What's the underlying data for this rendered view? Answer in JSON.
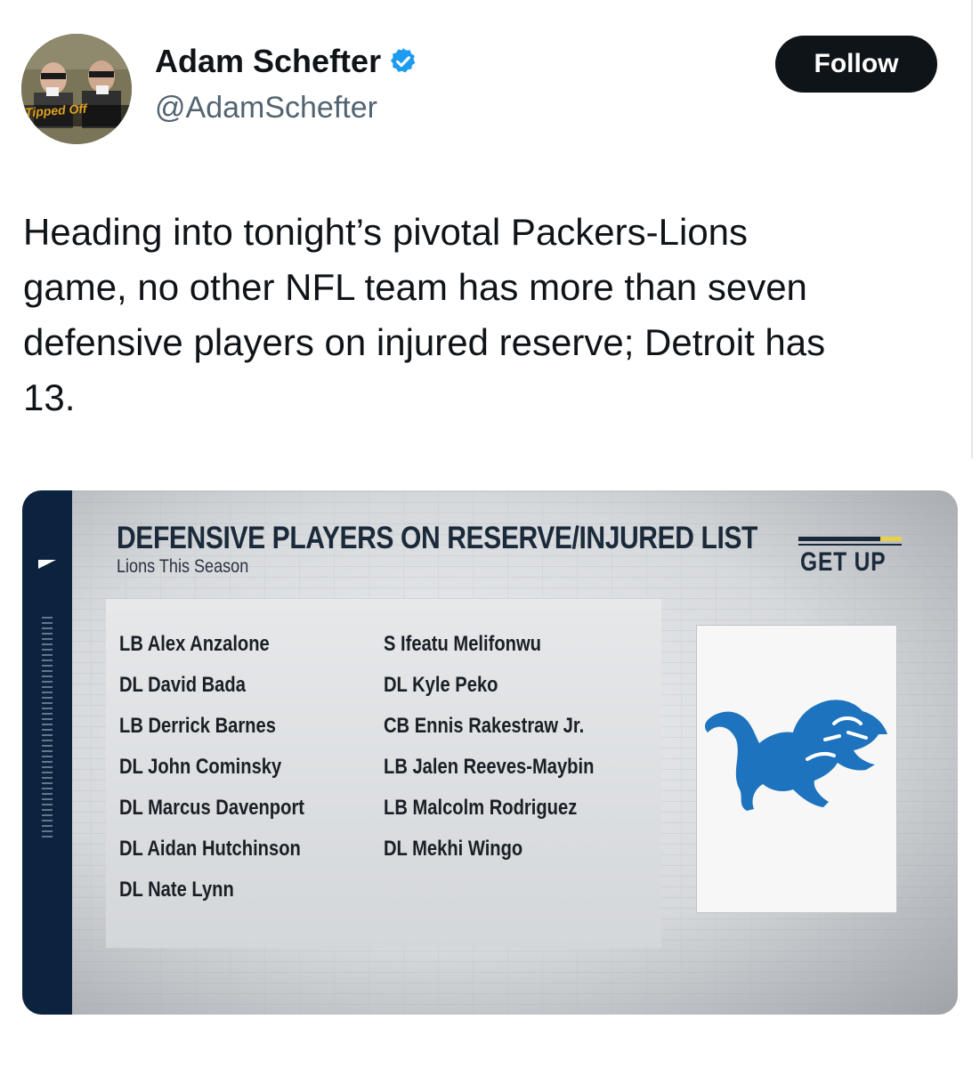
{
  "author": {
    "display_name": "Adam Schefter",
    "handle": "@AdamSchefter",
    "avatar_text": "Tipped Off",
    "verified_icon": "verified-badge-icon"
  },
  "actions": {
    "follow_label": "Follow"
  },
  "tweet": {
    "text": "Heading into tonight’s pivotal Packers-Lions\ngame, no other NFL team has more than seven\ndefensive players on injured reserve; Detroit has\n13."
  },
  "media": {
    "title": "DEFENSIVE PLAYERS ON RESERVE/INJURED LIST",
    "subtitle": "Lions This Season",
    "brand": "GET UP",
    "logo_icon": "detroit-lions-logo-icon",
    "colors": {
      "strip": "#0c2340",
      "lions_blue": "#1e73be",
      "brand_accent": "#e7d04a"
    },
    "players_col1": [
      "LB Alex Anzalone",
      "DL David Bada",
      "LB Derrick Barnes",
      "DL John Cominsky",
      "DL Marcus Davenport",
      "DL Aidan Hutchinson",
      "DL Nate Lynn"
    ],
    "players_col2": [
      "S Ifeatu Melifonwu",
      "DL Kyle Peko",
      "CB Ennis Rakestraw Jr.",
      "LB Jalen Reeves-Maybin",
      "LB Malcolm Rodriguez",
      "DL Mekhi Wingo"
    ]
  }
}
